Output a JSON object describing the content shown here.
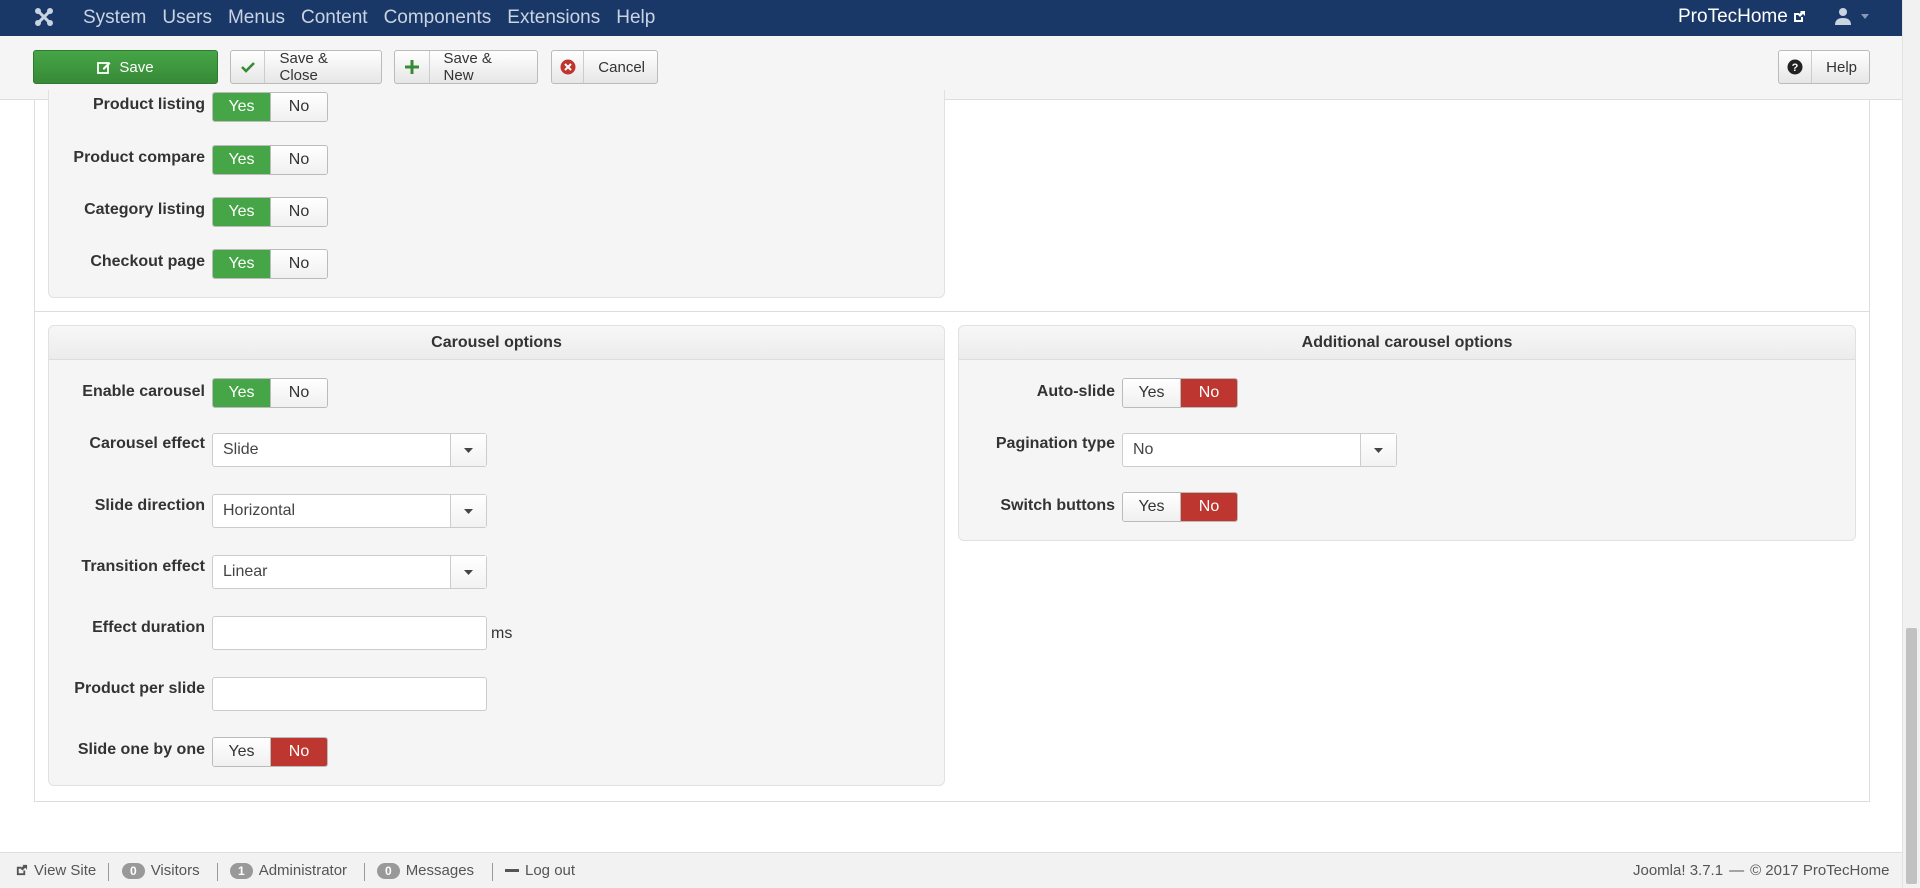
{
  "navbar": {
    "menu": [
      "System",
      "Users",
      "Menus",
      "Content",
      "Components",
      "Extensions",
      "Help"
    ],
    "site_name": "ProTecHome",
    "logo_icon": "joomla-logo-icon",
    "user_icon": "user-icon"
  },
  "toolbar": {
    "save_label": "Save",
    "save_close_label": "Save & Close",
    "save_new_label": "Save & New",
    "cancel_label": "Cancel",
    "help_label": "Help"
  },
  "display_options": {
    "rows": [
      {
        "label": "Product listing",
        "yes": "Yes",
        "no": "No",
        "value": "Yes"
      },
      {
        "label": "Product compare",
        "yes": "Yes",
        "no": "No",
        "value": "Yes"
      },
      {
        "label": "Category listing",
        "yes": "Yes",
        "no": "No",
        "value": "Yes"
      },
      {
        "label": "Checkout page",
        "yes": "Yes",
        "no": "No",
        "value": "Yes"
      }
    ]
  },
  "carousel": {
    "title": "Carousel options",
    "enable_carousel": {
      "label": "Enable carousel",
      "yes": "Yes",
      "no": "No",
      "value": "Yes"
    },
    "carousel_effect": {
      "label": "Carousel effect",
      "value": "Slide"
    },
    "slide_direction": {
      "label": "Slide direction",
      "value": "Horizontal"
    },
    "transition_effect": {
      "label": "Transition effect",
      "value": "Linear"
    },
    "effect_duration": {
      "label": "Effect duration",
      "value": "",
      "unit": "ms"
    },
    "product_per_slide": {
      "label": "Product per slide",
      "value": ""
    },
    "slide_one_by_one": {
      "label": "Slide one by one",
      "yes": "Yes",
      "no": "No",
      "value": "No"
    }
  },
  "additional": {
    "title": "Additional carousel options",
    "auto_slide": {
      "label": "Auto-slide",
      "yes": "Yes",
      "no": "No",
      "value": "No"
    },
    "pagination_type": {
      "label": "Pagination type",
      "value": "No"
    },
    "switch_buttons": {
      "label": "Switch buttons",
      "yes": "Yes",
      "no": "No",
      "value": "No"
    }
  },
  "statusbar": {
    "view_site": "View Site",
    "visitors_count": "0",
    "visitors_label": "Visitors",
    "admin_count": "1",
    "admin_label": "Administrator",
    "messages_count": "0",
    "messages_label": "Messages",
    "logout": "Log out",
    "version": "Joomla! 3.7.1",
    "sep": "—",
    "copyright": "© 2017 ProTecHome"
  },
  "colors": {
    "navbar": "#1a3867",
    "success": "#46a546",
    "danger": "#bd362f"
  }
}
